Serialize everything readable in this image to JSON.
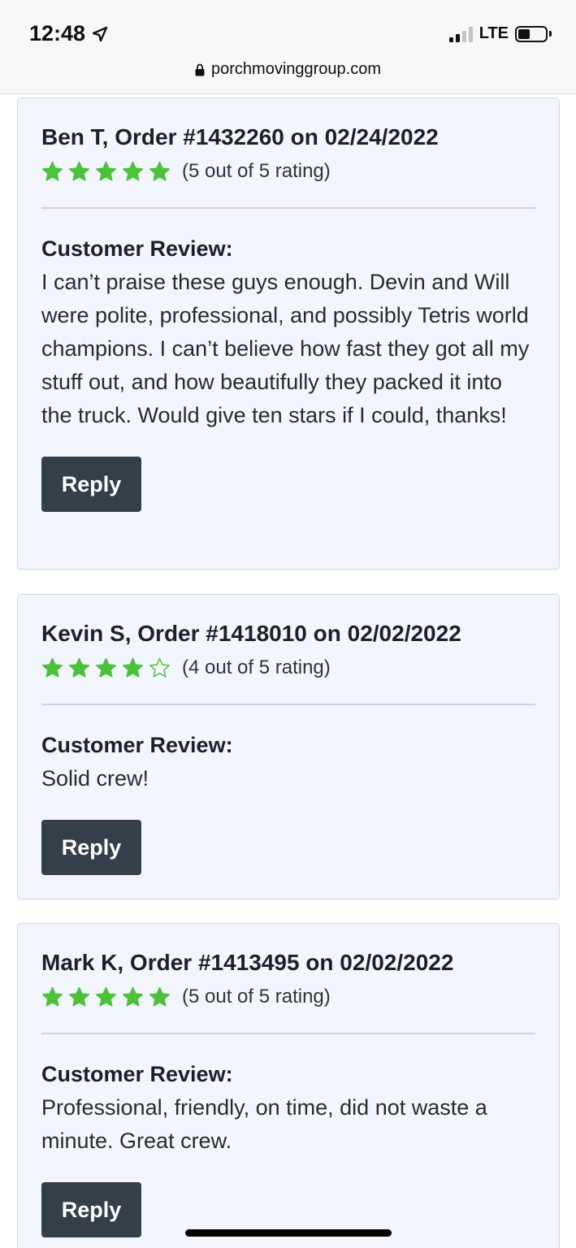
{
  "status_bar": {
    "time": "12:48",
    "network": "LTE",
    "url": "porchmovinggroup.com"
  },
  "colors": {
    "star_green": "#4cc13a",
    "button_bg": "#343f49",
    "card_bg": "#f2f6fc"
  },
  "reviews": [
    {
      "title": "Ben T, Order #1432260 on 02/24/2022",
      "rating": 5,
      "rating_text": "(5 out of 5 rating)",
      "label": "Customer Review:",
      "text": "I can’t praise these guys enough. Devin and Will were polite, professional, and possibly Tetris world champions. I can’t believe how fast they got all my stuff out, and how beautifully they packed it into the truck. Would give ten stars if I could, thanks!",
      "reply_label": "Reply"
    },
    {
      "title": "Kevin S, Order #1418010 on 02/02/2022",
      "rating": 4,
      "rating_text": "(4 out of 5 rating)",
      "label": "Customer Review:",
      "text": "Solid crew!",
      "reply_label": "Reply"
    },
    {
      "title": "Mark K, Order #1413495 on 02/02/2022",
      "rating": 5,
      "rating_text": "(5 out of 5 rating)",
      "label": "Customer Review:",
      "text": "Professional, friendly, on time, did not waste a minute. Great crew.",
      "reply_label": "Reply"
    }
  ]
}
